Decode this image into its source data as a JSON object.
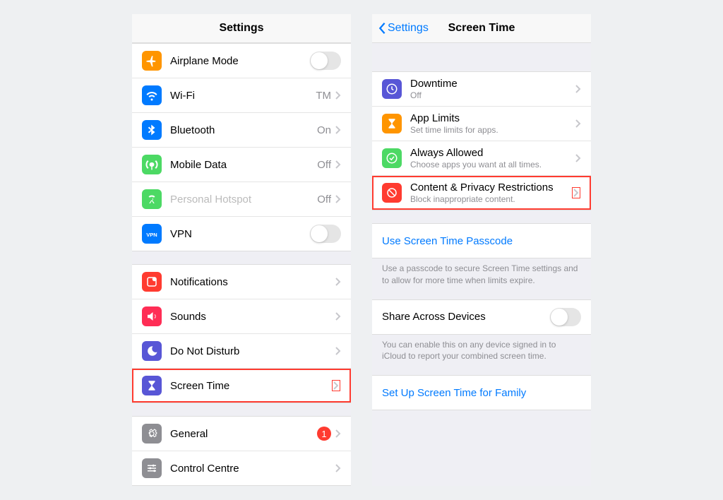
{
  "left": {
    "title": "Settings",
    "g1": [
      {
        "icon": "airplane",
        "color": "#ff9500",
        "label": "Airplane Mode",
        "toggle": true
      },
      {
        "icon": "wifi",
        "color": "#007aff",
        "label": "Wi-Fi",
        "detail": "TM",
        "chev": true
      },
      {
        "icon": "bluetooth",
        "color": "#007aff",
        "label": "Bluetooth",
        "detail": "On",
        "chev": true
      },
      {
        "icon": "antenna",
        "color": "#4cd964",
        "label": "Mobile Data",
        "detail": "Off",
        "chev": true
      },
      {
        "icon": "hotspot",
        "color": "#4cd964",
        "label": "Personal Hotspot",
        "detail": "Off",
        "chev": true,
        "dim": true
      },
      {
        "icon": "vpn",
        "color": "#007aff",
        "label": "VPN",
        "toggle": true
      }
    ],
    "g2": [
      {
        "icon": "notif",
        "color": "#ff3b30",
        "label": "Notifications",
        "chev": true
      },
      {
        "icon": "sound",
        "color": "#ff2d55",
        "label": "Sounds",
        "chev": true
      },
      {
        "icon": "moon",
        "color": "#5856d6",
        "label": "Do Not Disturb",
        "chev": true
      },
      {
        "icon": "hourglass",
        "color": "#5856d6",
        "label": "Screen Time",
        "chev": true,
        "hl": true
      }
    ],
    "g3": [
      {
        "icon": "gear",
        "color": "#8e8e93",
        "label": "General",
        "chev": true,
        "badge": "1"
      },
      {
        "icon": "sliders",
        "color": "#8e8e93",
        "label": "Control Centre",
        "chev": true
      }
    ]
  },
  "right": {
    "back": "Settings",
    "title": "Screen Time",
    "g1": [
      {
        "icon": "clock",
        "color": "#5856d6",
        "t": "Downtime",
        "s": "Off"
      },
      {
        "icon": "hourglass",
        "color": "#ff9500",
        "t": "App Limits",
        "s": "Set time limits for apps."
      },
      {
        "icon": "check",
        "color": "#4cd964",
        "t": "Always Allowed",
        "s": "Choose apps you want at all times."
      },
      {
        "icon": "nosign",
        "color": "#ff3b30",
        "t": "Content & Privacy Restrictions",
        "s": "Block inappropriate content.",
        "hl": true
      }
    ],
    "passcode": "Use Screen Time Passcode",
    "passcode_foot": "Use a passcode to secure Screen Time settings and to allow for more time when limits expire.",
    "share": "Share Across Devices",
    "share_foot": "You can enable this on any device signed in to iCloud to report your combined screen time.",
    "family": "Set Up Screen Time for Family"
  }
}
